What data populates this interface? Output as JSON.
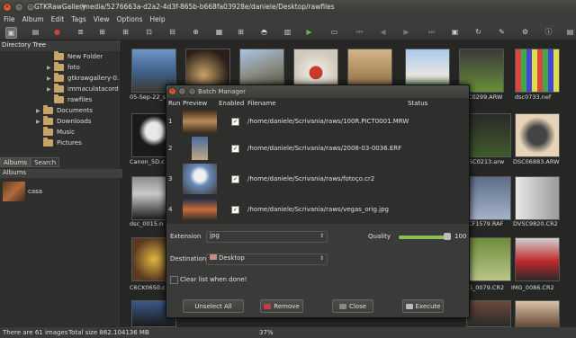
{
  "window": {
    "title": "GTKRawGallery",
    "path": "/media/5276663a-d2a2-4d3f-865b-b668fa03928e/daniele/Desktop/rawfiles"
  },
  "menu": [
    "File",
    "Album",
    "Edit",
    "Tags",
    "View",
    "Options",
    "Help"
  ],
  "sidebar": {
    "tree_title": "Directory Tree",
    "tree": [
      {
        "label": "New Folder",
        "has_children": false
      },
      {
        "label": "foto",
        "has_children": true
      },
      {
        "label": "gtkrawgallery-0.",
        "has_children": true
      },
      {
        "label": "immaculatacord",
        "has_children": true
      },
      {
        "label": "rawfiles",
        "has_children": false
      },
      {
        "label": "Documents",
        "has_children": true
      },
      {
        "label": "Downloads",
        "has_children": true
      },
      {
        "label": "Music",
        "has_children": false
      },
      {
        "label": "Pictures",
        "has_children": false
      }
    ],
    "tabs": [
      "Albums",
      "Search"
    ],
    "albums_header": "Albums",
    "albums": [
      {
        "label": "casa"
      }
    ]
  },
  "gallery": {
    "labels_top": [
      "05-Sep-22_s",
      "SC0299.ARW",
      "dsc0733.nef"
    ],
    "labels": [
      "Canon_5D.c",
      "DSC0213.arw",
      "DSC06883.ARW",
      "dsc_0015.n",
      "CF1579.RAF",
      "DVSC9820.CR2",
      "C6CK0650.c",
      "G_0079.CR2",
      "IMG_0086.CR2"
    ]
  },
  "dialog": {
    "title": "Batch Manager",
    "columns": [
      "Run",
      "Preview",
      "Enabled",
      "Filename",
      "Status"
    ],
    "rows": [
      {
        "run": "1",
        "enabled": true,
        "filename": "/home/daniele/Scrivania/raws/100R.PICT0001.MRW"
      },
      {
        "run": "2",
        "enabled": true,
        "filename": "/home/daniele/Scrivania/raws/2008-03-0036.ERF"
      },
      {
        "run": "3",
        "enabled": true,
        "filename": "/home/daniele/Scrivania/raws/fotoço.cr2"
      },
      {
        "run": "4",
        "enabled": true,
        "filename": "/home/daniele/Scrivania/raws/vegas_orig.jpg"
      }
    ],
    "extension_label": "Extension",
    "extension_value": "jpg",
    "quality_label": "Quality",
    "quality_value": "100",
    "destination_label": "Destination",
    "destination_value": "Desktop",
    "clear_label": "Clear list when done!",
    "clear_checked": false,
    "buttons": {
      "unselect": "Unselect All",
      "remove": "Remove",
      "close": "Close",
      "execute": "Execute"
    }
  },
  "status": {
    "images": "There are 61 images",
    "size": "Total size 862.104136 MB",
    "zoom": "37%"
  }
}
